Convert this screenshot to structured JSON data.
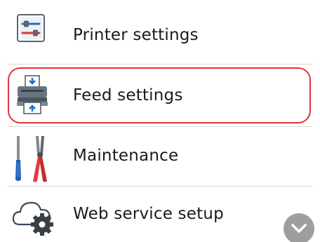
{
  "menu": {
    "items": [
      {
        "label": "Printer settings",
        "icon": "printer-settings-icon"
      },
      {
        "label": "Feed settings",
        "icon": "feed-settings-icon",
        "selected": true
      },
      {
        "label": "Maintenance",
        "icon": "maintenance-tools-icon"
      },
      {
        "label": "Web service setup",
        "icon": "cloud-gear-icon"
      }
    ]
  },
  "scroll": {
    "icon": "chevron-down-icon"
  },
  "colors": {
    "selection_outline": "#e0333a",
    "scroll_button": "#9e9e9e",
    "divider": "#d8d8d8"
  }
}
